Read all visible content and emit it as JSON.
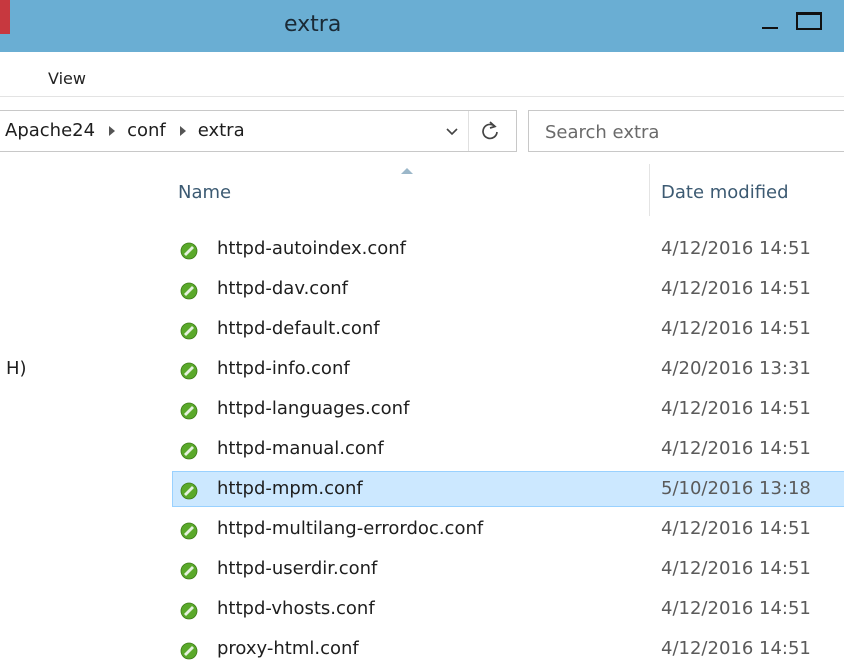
{
  "window": {
    "title": "extra"
  },
  "ribbon": {
    "view_label": "View"
  },
  "address": {
    "crumbs": [
      "Apache24",
      "conf",
      "extra"
    ]
  },
  "search": {
    "placeholder": "Search extra"
  },
  "columns": {
    "name": "Name",
    "date_modified": "Date modified"
  },
  "nav": {
    "partial_label": "H)"
  },
  "files": [
    {
      "name": "httpd-autoindex.conf",
      "date": "4/12/2016 14:51",
      "selected": false
    },
    {
      "name": "httpd-dav.conf",
      "date": "4/12/2016 14:51",
      "selected": false
    },
    {
      "name": "httpd-default.conf",
      "date": "4/12/2016 14:51",
      "selected": false
    },
    {
      "name": "httpd-info.conf",
      "date": "4/20/2016 13:31",
      "selected": false
    },
    {
      "name": "httpd-languages.conf",
      "date": "4/12/2016 14:51",
      "selected": false
    },
    {
      "name": "httpd-manual.conf",
      "date": "4/12/2016 14:51",
      "selected": false
    },
    {
      "name": "httpd-mpm.conf",
      "date": "5/10/2016 13:18",
      "selected": true
    },
    {
      "name": "httpd-multilang-errordoc.conf",
      "date": "4/12/2016 14:51",
      "selected": false
    },
    {
      "name": "httpd-userdir.conf",
      "date": "4/12/2016 14:51",
      "selected": false
    },
    {
      "name": "httpd-vhosts.conf",
      "date": "4/12/2016 14:51",
      "selected": false
    },
    {
      "name": "proxy-html.conf",
      "date": "4/12/2016 14:51",
      "selected": false
    }
  ],
  "icons": {
    "file": "conf-file-icon",
    "refresh": "refresh-icon",
    "dropdown": "chevron-down-icon"
  },
  "colors": {
    "titlebar": "#6aaed3",
    "selection": "#cce8ff",
    "file_icon": "#5aa92a"
  }
}
